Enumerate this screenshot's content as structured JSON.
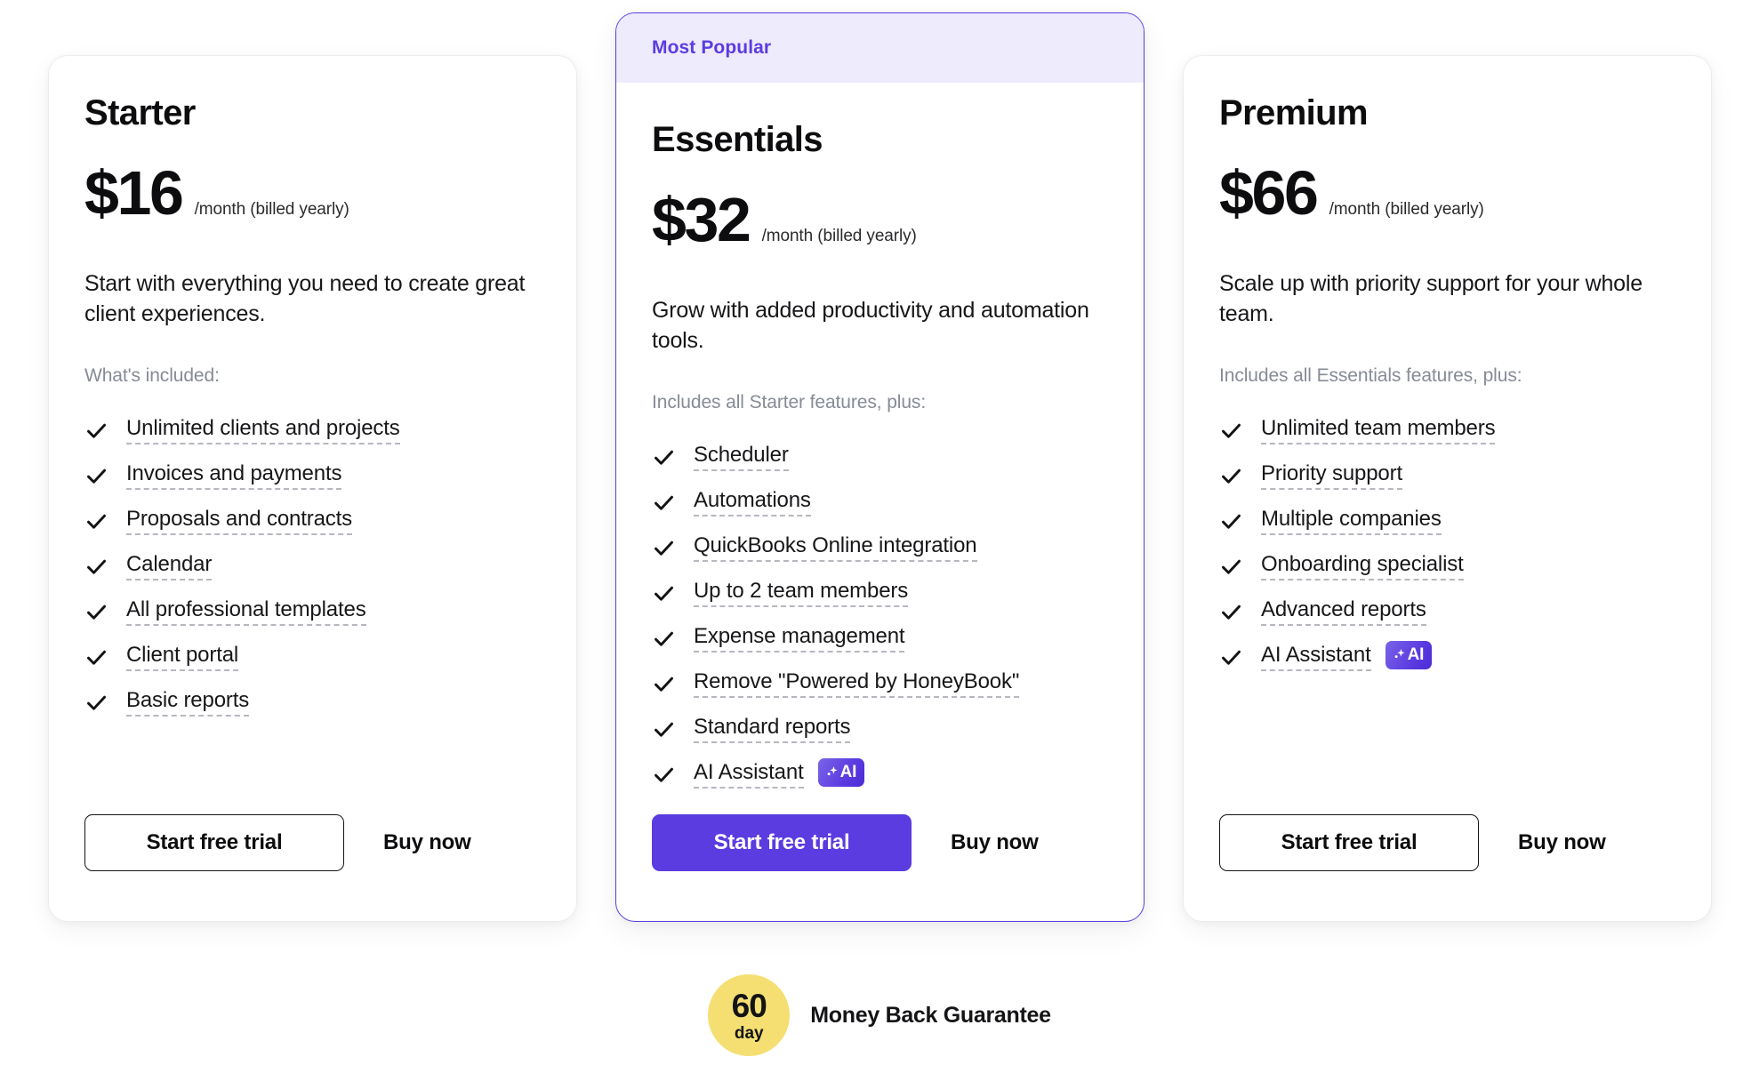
{
  "colors": {
    "accent_purple": "#5B3CE0",
    "popular_band_bg": "#EEEBFC",
    "seal_yellow": "#F5DF72",
    "muted_gray": "#868b95",
    "text_dark": "#17171a"
  },
  "plans": [
    {
      "featured": false,
      "badge_label": "",
      "name": "Starter",
      "price": "$16",
      "period": "/month (billed yearly)",
      "description": "Start with everything you need to create great client experiences.",
      "included_label": "What's included:",
      "features": [
        {
          "label": "Unlimited clients and projects",
          "underline": true,
          "ai_badge": false
        },
        {
          "label": "Invoices and payments",
          "underline": true,
          "ai_badge": false
        },
        {
          "label": "Proposals and contracts",
          "underline": true,
          "ai_badge": false
        },
        {
          "label": "Calendar",
          "underline": true,
          "ai_badge": false
        },
        {
          "label": "All professional templates",
          "underline": true,
          "ai_badge": false
        },
        {
          "label": "Client portal",
          "underline": true,
          "ai_badge": false
        },
        {
          "label": "Basic reports",
          "underline": true,
          "ai_badge": false
        }
      ],
      "trial_label": "Start free trial",
      "buy_label": "Buy now"
    },
    {
      "featured": true,
      "badge_label": "Most Popular",
      "name": "Essentials",
      "price": "$32",
      "period": "/month (billed yearly)",
      "description": "Grow with added productivity and automation tools.",
      "included_label": "Includes all Starter features, plus:",
      "features": [
        {
          "label": "Scheduler",
          "underline": true,
          "ai_badge": false
        },
        {
          "label": "Automations",
          "underline": true,
          "ai_badge": false
        },
        {
          "label": "QuickBooks Online integration",
          "underline": true,
          "ai_badge": false
        },
        {
          "label": "Up to 2 team members",
          "underline": true,
          "ai_badge": false
        },
        {
          "label": "Expense management",
          "underline": true,
          "ai_badge": false
        },
        {
          "label": "Remove \"Powered by HoneyBook\"",
          "underline": true,
          "ai_badge": false
        },
        {
          "label": "Standard reports",
          "underline": true,
          "ai_badge": false
        },
        {
          "label": "AI Assistant",
          "underline": true,
          "ai_badge": true,
          "ai_badge_label": "AI"
        }
      ],
      "trial_label": "Start free trial",
      "buy_label": "Buy now"
    },
    {
      "featured": false,
      "badge_label": "",
      "name": "Premium",
      "price": "$66",
      "period": "/month (billed yearly)",
      "description": "Scale up with priority support for your whole team.",
      "included_label": "Includes all Essentials features, plus:",
      "features": [
        {
          "label": "Unlimited team members",
          "underline": true,
          "ai_badge": false
        },
        {
          "label": "Priority support",
          "underline": true,
          "ai_badge": false
        },
        {
          "label": "Multiple companies",
          "underline": true,
          "ai_badge": false
        },
        {
          "label": "Onboarding specialist",
          "underline": true,
          "ai_badge": false
        },
        {
          "label": "Advanced reports",
          "underline": true,
          "ai_badge": false
        },
        {
          "label": "AI Assistant",
          "underline": true,
          "ai_badge": true,
          "ai_badge_label": "AI"
        }
      ],
      "trial_label": "Start free trial",
      "buy_label": "Buy now"
    }
  ],
  "guarantee": {
    "seal_number": "60",
    "seal_unit": "day",
    "text": "Money Back Guarantee"
  }
}
